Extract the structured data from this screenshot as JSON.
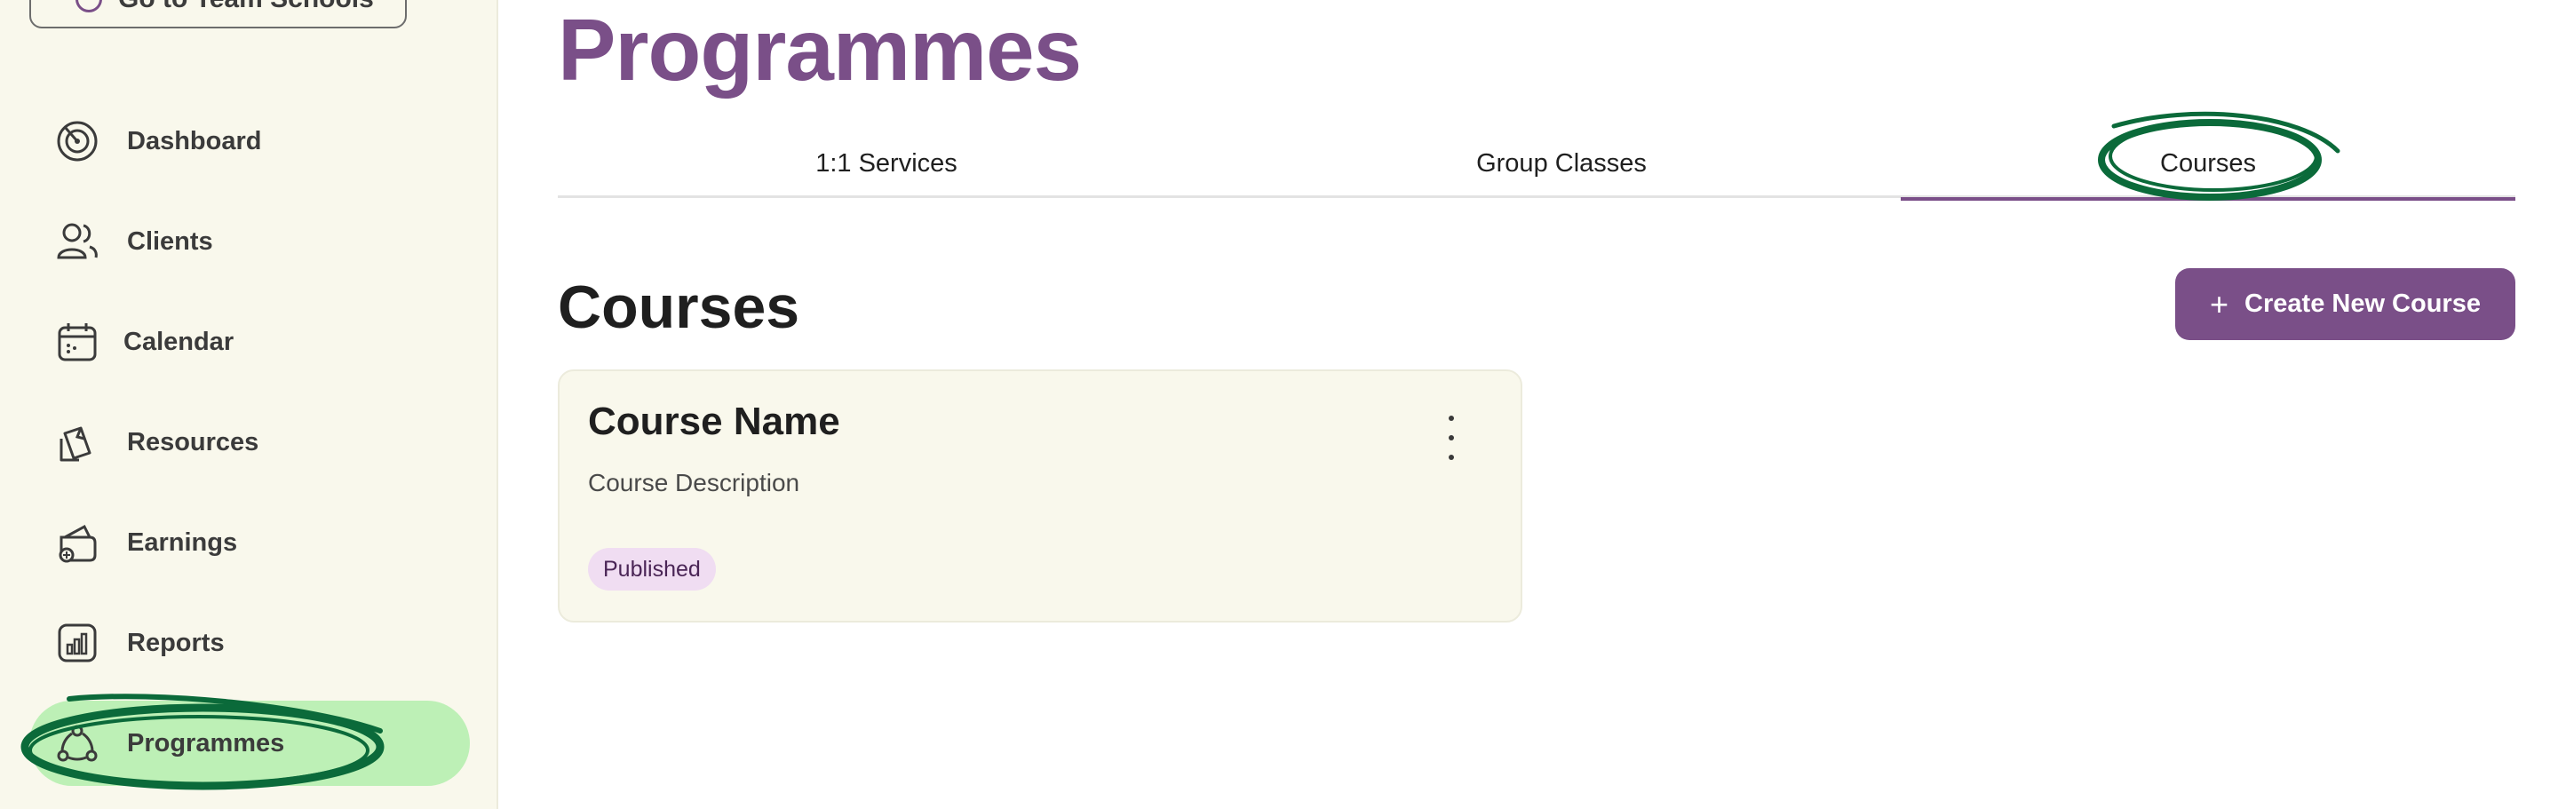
{
  "sidebar": {
    "team_button_label": "Go to Team Schools",
    "items": [
      {
        "label": "Dashboard",
        "icon": "dashboard-icon"
      },
      {
        "label": "Clients",
        "icon": "clients-icon"
      },
      {
        "label": "Calendar",
        "icon": "calendar-icon"
      },
      {
        "label": "Resources",
        "icon": "resources-icon"
      },
      {
        "label": "Earnings",
        "icon": "earnings-icon"
      },
      {
        "label": "Reports",
        "icon": "reports-icon"
      },
      {
        "label": "Programmes",
        "icon": "programmes-icon",
        "active": true
      }
    ]
  },
  "main": {
    "title": "Programmes",
    "tabs": [
      {
        "label": "1:1 Services"
      },
      {
        "label": "Group Classes"
      },
      {
        "label": "Courses",
        "active": true
      }
    ],
    "section_title": "Courses",
    "create_button": "Create New Course",
    "courses": [
      {
        "name": "Course Name",
        "description": "Course Description",
        "status": "Published"
      }
    ]
  },
  "colors": {
    "accent": "#7a4f88",
    "sidebar_bg": "#f9f8ec",
    "active_nav_bg": "#bdf0b6",
    "highlight_scribble": "#0b6a3a",
    "badge_bg": "#f0ddf2"
  }
}
